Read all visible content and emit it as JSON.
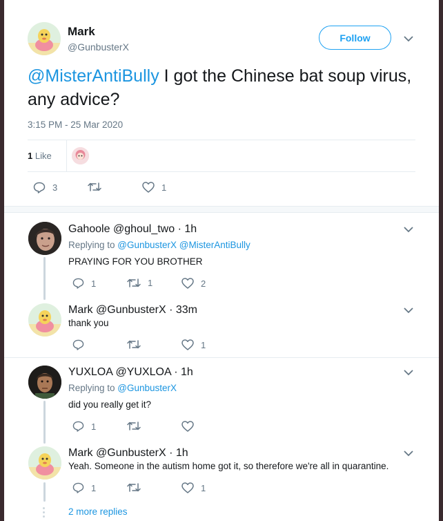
{
  "tweet": {
    "author_name": "Mark",
    "author_handle": "@GunbusterX",
    "follow_label": "Follow",
    "mention": "@MisterAntiBully",
    "text": " I got the Chinese bat soup virus, any advice?",
    "timestamp": "3:15 PM - 25 Mar 2020",
    "like_count": "1",
    "like_label": " Like",
    "reply_count": "3",
    "retweet_count": "",
    "heart_count": "1"
  },
  "replies": [
    {
      "name": "Gahoole",
      "meta": " @ghoul_two · 1h",
      "replying_prefix": "Replying to ",
      "replying_to": "@GunbusterX @MisterAntiBully",
      "text": "PRAYING FOR YOU BROTHER",
      "reply_count": "1",
      "retweet_count": "1",
      "heart_count": "2"
    },
    {
      "name": "Mark",
      "meta": " @GunbusterX · 33m",
      "text": "thank you",
      "reply_count": "",
      "retweet_count": "",
      "heart_count": "1"
    },
    {
      "name": "YUXLOA",
      "meta": " @YUXLOA · 1h",
      "replying_prefix": "Replying to ",
      "replying_to": "@GunbusterX",
      "text": "did you really get it?",
      "reply_count": "1",
      "retweet_count": "",
      "heart_count": ""
    },
    {
      "name": "Mark",
      "meta": " @GunbusterX · 1h",
      "text": "Yeah. Someone in the autism home got it, so therefore we're all in quarantine.",
      "reply_count": "1",
      "retweet_count": "",
      "heart_count": "1"
    }
  ],
  "more_replies": "2 more replies",
  "colors": {
    "accent": "#1da1f2",
    "link": "#1b95e0",
    "muted": "#657786",
    "border": "#e6ecf0"
  },
  "icons": [
    "chevron-down-icon",
    "reply-icon",
    "retweet-icon",
    "heart-icon"
  ]
}
